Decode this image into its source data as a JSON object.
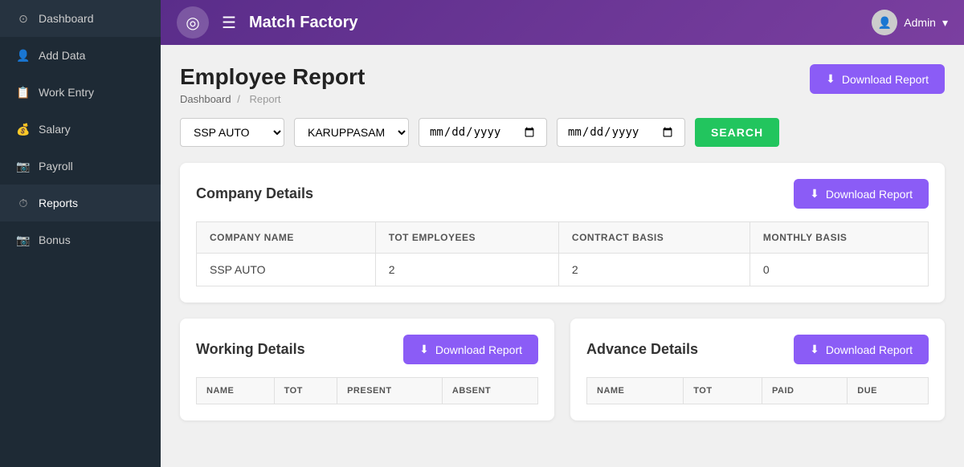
{
  "topbar": {
    "title": "Match Factory",
    "menu_icon": "☰",
    "logo_icon": "◎",
    "user_label": "Admin",
    "user_dropdown": "▾",
    "user_avatar": "👤"
  },
  "sidebar": {
    "items": [
      {
        "id": "dashboard",
        "label": "Dashboard",
        "icon": "⊙"
      },
      {
        "id": "add-data",
        "label": "Add Data",
        "icon": "👤"
      },
      {
        "id": "work-entry",
        "label": "Work Entry",
        "icon": "📋"
      },
      {
        "id": "salary",
        "label": "Salary",
        "icon": "💰"
      },
      {
        "id": "payroll",
        "label": "Payroll",
        "icon": "📷"
      },
      {
        "id": "reports",
        "label": "Reports",
        "icon": "⏱"
      },
      {
        "id": "bonus",
        "label": "Bonus",
        "icon": "📷"
      }
    ]
  },
  "page": {
    "title": "Employee Report",
    "breadcrumb_home": "Dashboard",
    "breadcrumb_sep": "/",
    "breadcrumb_current": "Report"
  },
  "header_download_btn": "Download Report",
  "filters": {
    "company_value": "SSP AUTO",
    "employee_value": "KARUPPASAM",
    "date_from_placeholder": "mm/dd/yyyy",
    "date_to_placeholder": "mm/dd/yyyy",
    "search_label": "SEARCH"
  },
  "company_details": {
    "card_title": "Company Details",
    "download_btn": "Download Report",
    "columns": [
      "COMPANY NAME",
      "TOT EMPLOYEES",
      "CONTRACT BASIS",
      "MONTHLY BASIS"
    ],
    "rows": [
      {
        "company_name": "SSP AUTO",
        "tot_employees": "2",
        "contract_basis": "2",
        "monthly_basis": "0"
      }
    ]
  },
  "working_details": {
    "card_title": "Working Details",
    "download_btn": "Download Report",
    "columns": [
      "NAME",
      "TOT",
      "PRESENT",
      "ABSENT"
    ]
  },
  "advance_details": {
    "card_title": "Advance Details",
    "download_btn": "Download Report",
    "columns": [
      "NAME",
      "TOT",
      "PAID",
      "DUE"
    ]
  },
  "icons": {
    "download": "⬇"
  }
}
